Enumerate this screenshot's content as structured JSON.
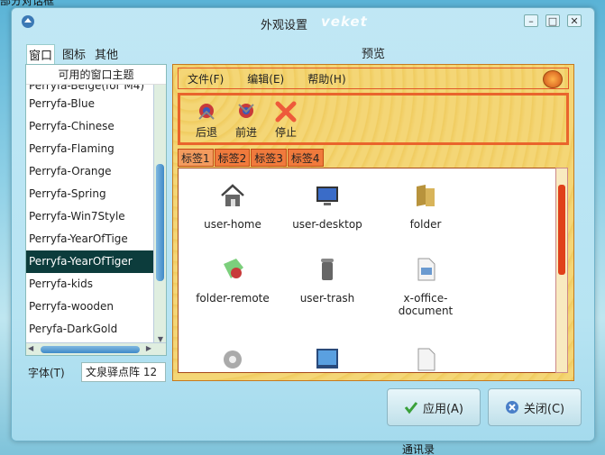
{
  "background": {
    "top_left_text": "部分对话框",
    "bottom_text": "通讯录"
  },
  "window": {
    "title": "外观设置",
    "brand": "veket",
    "controls": {
      "minimize": "–",
      "maximize": "□",
      "close": "✕"
    }
  },
  "tabs": [
    {
      "label": "窗口",
      "active": true
    },
    {
      "label": "图标",
      "active": false
    },
    {
      "label": "其他",
      "active": false
    }
  ],
  "themes": {
    "header": "可用的窗口主题",
    "items": [
      "Perryfa-Beige(for M4)",
      "Perryfa-Blue",
      "Perryfa-Chinese",
      "Perryfa-Flaming",
      "Perryfa-Orange",
      "Perryfa-Spring",
      "Perryfa-Win7Style",
      "Perryfa-YearOfTige",
      "Perryfa-YearOfTiger",
      "Perryfa-kids",
      "Perryfa-wooden",
      "Peryfa-DarkGold"
    ],
    "selected": "Perryfa-YearOfTiger"
  },
  "font": {
    "label": "字体(T)",
    "value": "文泉驿点阵 12"
  },
  "preview": {
    "label": "预览",
    "menus": [
      "文件(F)",
      "编辑(E)",
      "帮助(H)"
    ],
    "toolbar": [
      "后退",
      "前进",
      "停止"
    ],
    "tabs": [
      "标签1",
      "标签2",
      "标签3",
      "标签4"
    ],
    "icons": [
      {
        "name": "home-icon",
        "label": "user-home"
      },
      {
        "name": "desktop-icon",
        "label": "user-desktop"
      },
      {
        "name": "folder-icon",
        "label": "folder"
      },
      {
        "name": "folder-remote-icon",
        "label": "folder-remote"
      },
      {
        "name": "trash-icon",
        "label": "user-trash"
      },
      {
        "name": "document-icon",
        "label": "x-office-document"
      },
      {
        "name": "gear-icon",
        "label": ""
      },
      {
        "name": "image-icon",
        "label": ""
      },
      {
        "name": "text-file-icon",
        "label": ""
      }
    ]
  },
  "buttons": {
    "apply": "应用(A)",
    "close": "关闭(C)"
  }
}
